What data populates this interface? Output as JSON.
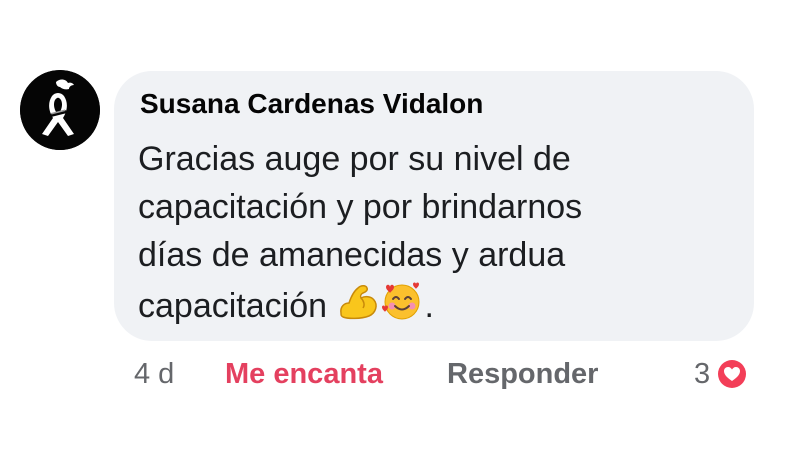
{
  "comment": {
    "author": "Susana Cardenas Vidalon",
    "lines": [
      "Gracias auge por su nivel de",
      "capacitación y por brindarnos",
      "días de amanecidas y ardua",
      "capacitación"
    ],
    "trailing_punct": ".",
    "emojis": [
      "flexed-biceps-emoji",
      "smiling-face-with-hearts-emoji"
    ]
  },
  "actions": {
    "time": "4 d",
    "reaction_label": "Me encanta",
    "reply_label": "Responder"
  },
  "reactions": {
    "count": "3",
    "icon": "heart-icon"
  },
  "colors": {
    "bubble": "#f0f2f5",
    "love": "#e4405f",
    "muted": "#65676b",
    "text": "#050505"
  }
}
